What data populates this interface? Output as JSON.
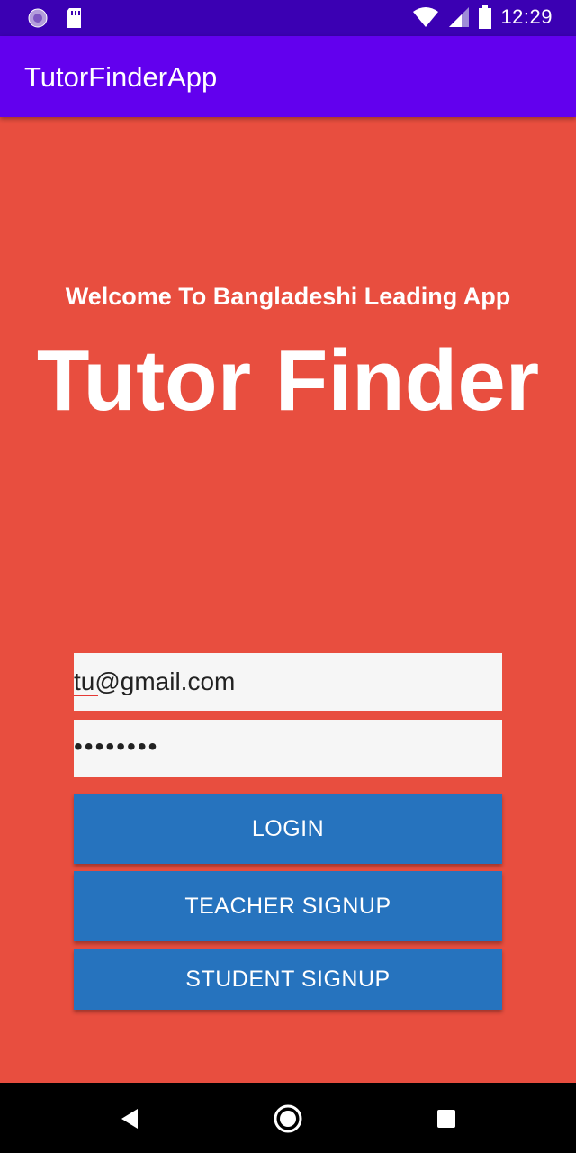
{
  "status_bar": {
    "time": "12:29",
    "icons": [
      "sync-icon",
      "sd-card-icon",
      "wifi-icon",
      "signal-icon",
      "battery-icon"
    ]
  },
  "app_bar": {
    "title": "TutorFinderApp"
  },
  "hero": {
    "welcome": "Welcome To Bangladeshi Leading App",
    "brand": "Tutor Finder"
  },
  "form": {
    "email_value": "tu@gmail.com",
    "password_value": "••••••••"
  },
  "buttons": {
    "login": "LOGIN",
    "teacher_signup": "TEACHER SIGNUP",
    "student_signup": "STUDENT SIGNUP"
  },
  "nav_bar": {
    "icons": [
      "back-icon",
      "home-icon",
      "recents-icon"
    ]
  },
  "colors": {
    "background": "#E84E3F",
    "status_bar": "#3B00B3",
    "app_bar": "#6200EE",
    "button": "#2673BE",
    "field": "#F6F6F6"
  }
}
